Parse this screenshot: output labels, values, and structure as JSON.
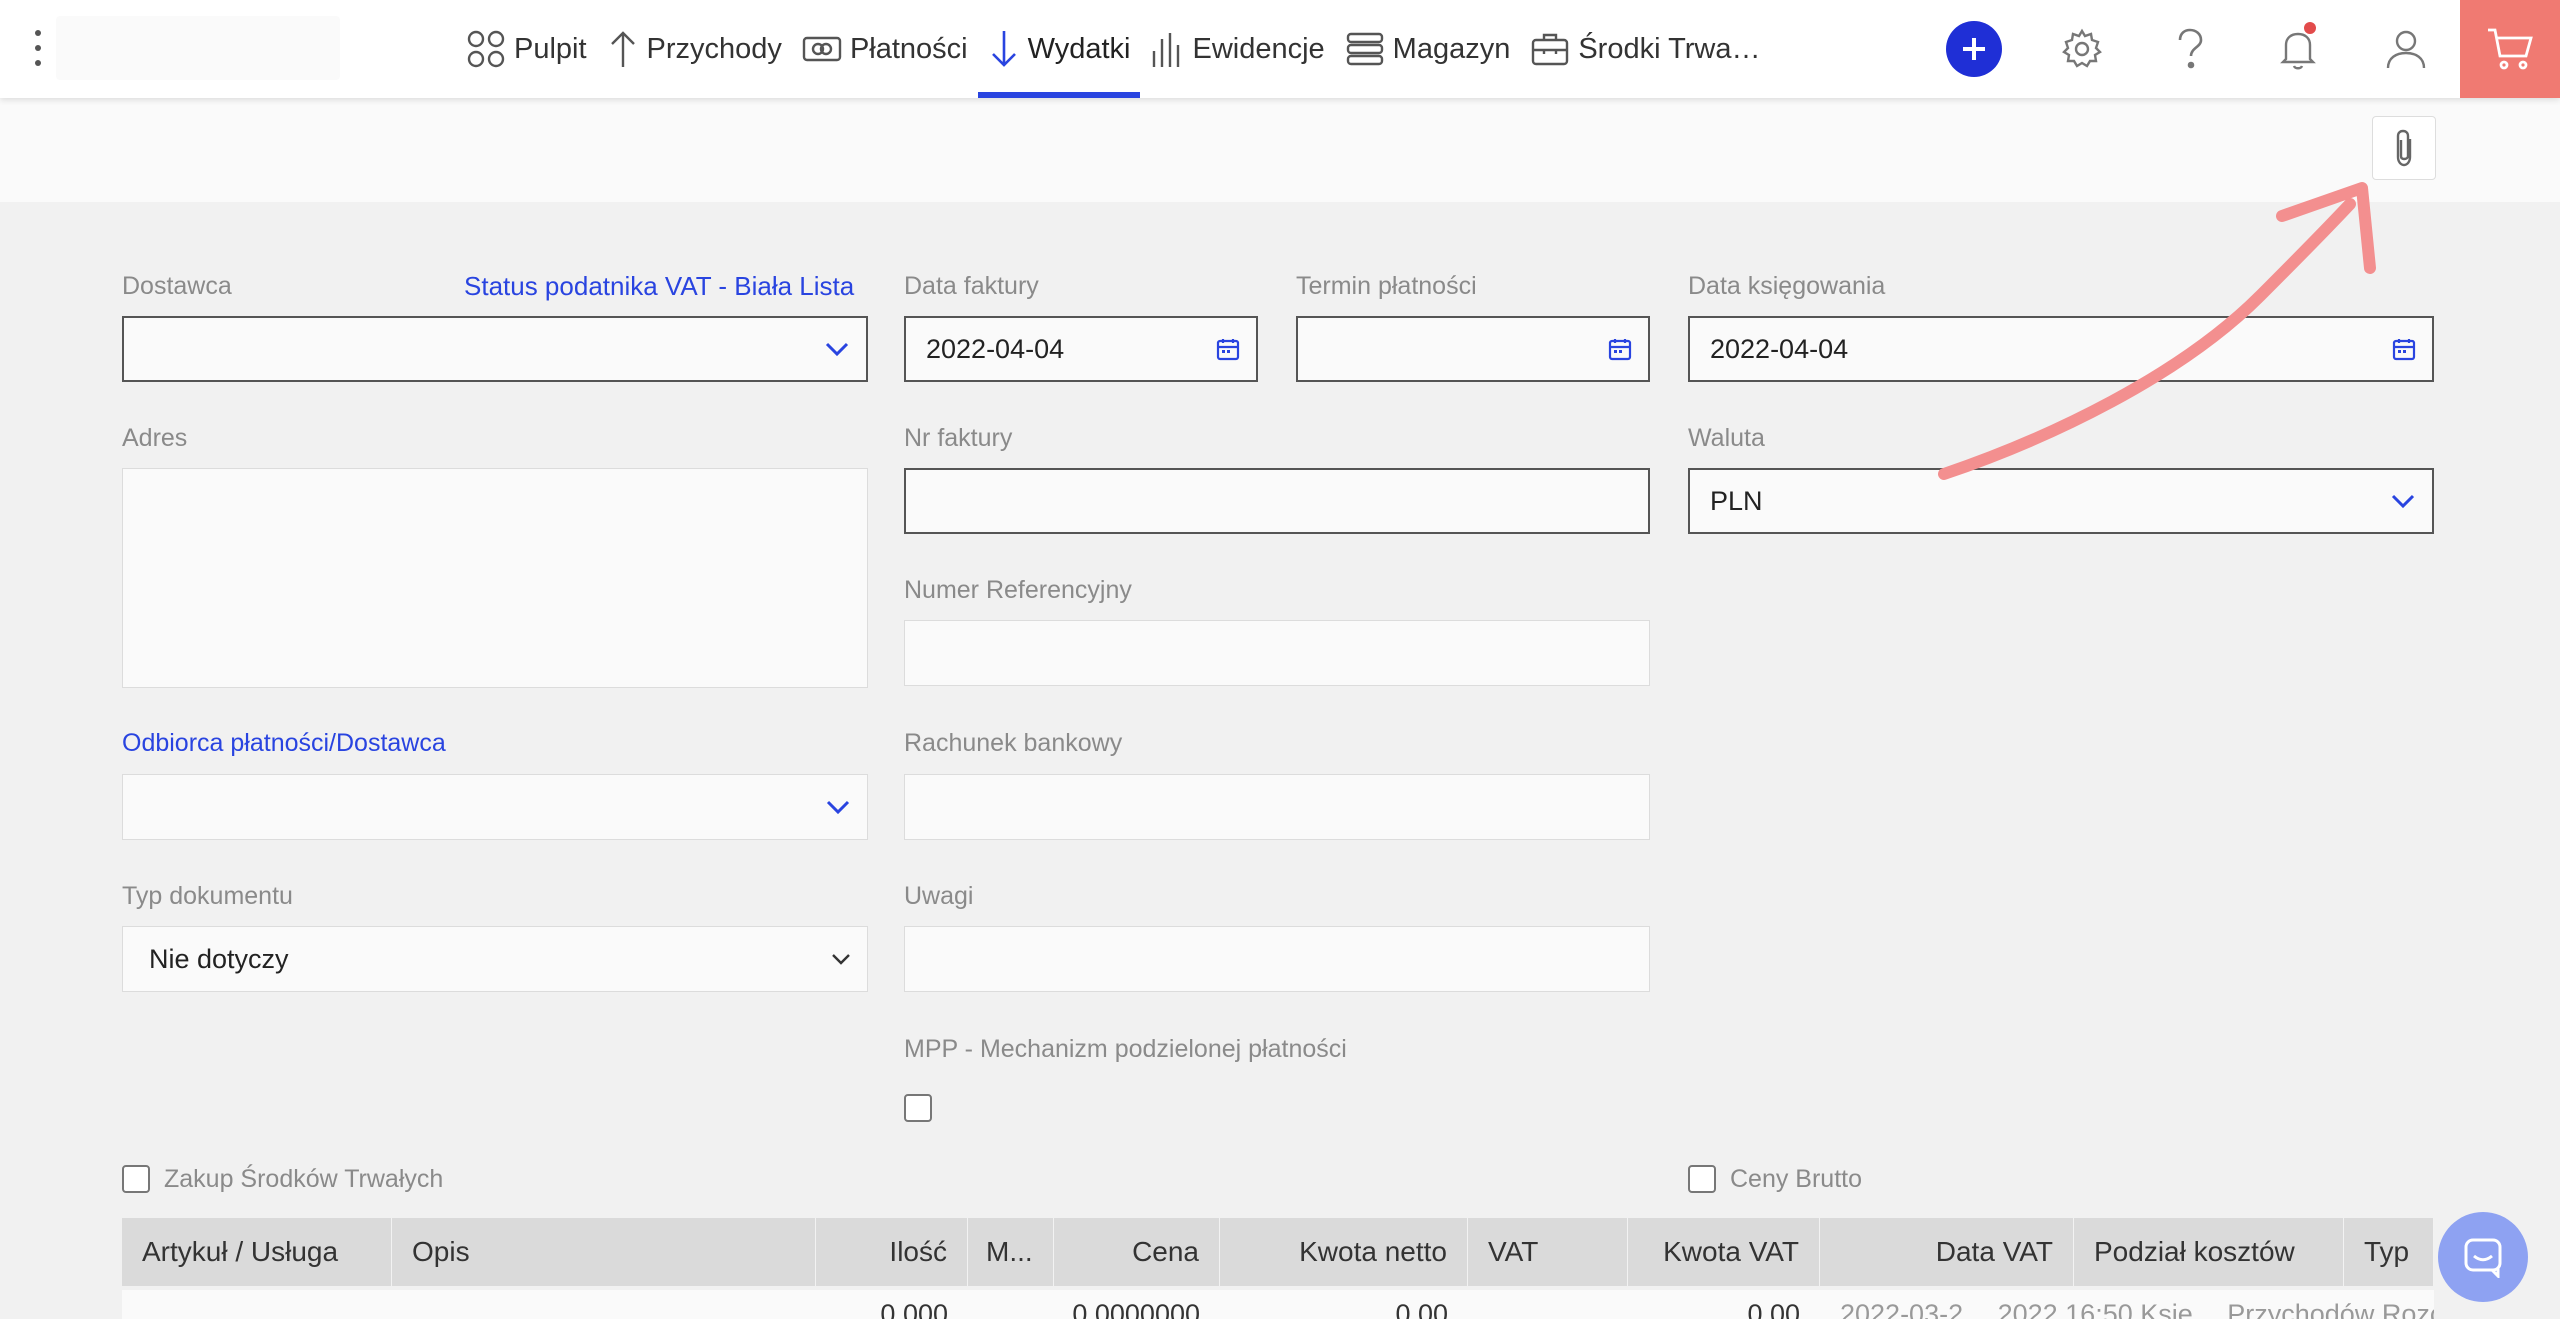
{
  "nav": {
    "items": [
      {
        "label": "Pulpit",
        "icon": "dashboard-icon"
      },
      {
        "label": "Przychody",
        "icon": "arrow-up-icon"
      },
      {
        "label": "Płatności",
        "icon": "money-icon"
      },
      {
        "label": "Wydatki",
        "icon": "arrow-down-icon",
        "active": true
      },
      {
        "label": "Ewidencje",
        "icon": "bar-chart-icon"
      },
      {
        "label": "Magazyn",
        "icon": "warehouse-icon"
      },
      {
        "label": "Środki Trwa…",
        "icon": "briefcase-icon"
      }
    ]
  },
  "colors": {
    "accent": "#2944e0",
    "cart": "#f07a72",
    "plus": "#1f2fd6",
    "annotation_arrow": "#f38f8f"
  },
  "form": {
    "supplier": {
      "label": "Dostawca",
      "value": ""
    },
    "vat_status_link": "Status podatnika VAT - Biała Lista",
    "invoice_date": {
      "label": "Data faktury",
      "value": "2022-04-04"
    },
    "payment_term": {
      "label": "Termin płatności",
      "value": ""
    },
    "posting_date": {
      "label": "Data księgowania",
      "value": "2022-04-04"
    },
    "address": {
      "label": "Adres",
      "value": ""
    },
    "invoice_number": {
      "label": "Nr faktury",
      "value": ""
    },
    "currency": {
      "label": "Waluta",
      "value": "PLN"
    },
    "reference_number": {
      "label": "Numer Referencyjny",
      "value": ""
    },
    "payee_link": "Odbiorca płatności/Dostawca",
    "payee": {
      "value": ""
    },
    "bank_account": {
      "label": "Rachunek bankowy",
      "value": ""
    },
    "document_type": {
      "label": "Typ dokumentu",
      "value": "Nie dotyczy"
    },
    "notes": {
      "label": "Uwagi",
      "value": ""
    },
    "split_payment": {
      "label": "MPP - Mechanizm podzielonej płatności",
      "checked": false
    },
    "fixed_assets_purchase": {
      "label": "Zakup Środków Trwałych",
      "checked": false
    },
    "gross_prices": {
      "label": "Ceny Brutto",
      "checked": false
    }
  },
  "table": {
    "headers": [
      "Artykuł / Usługa",
      "Opis",
      "Ilość",
      "M...",
      "Cena",
      "Kwota netto",
      "VAT",
      "Kwota VAT",
      "Data VAT",
      "Podział kosztów",
      "Typ"
    ],
    "row": {
      "quantity": "0,000",
      "price": "0,0000000",
      "net_amount": "0,00",
      "vat_amount": "0,00",
      "vat_date_cost_type": "2022-03-2… 2022 16:50 Księ… Przychodów Rozchodów (KPiR)"
    }
  }
}
